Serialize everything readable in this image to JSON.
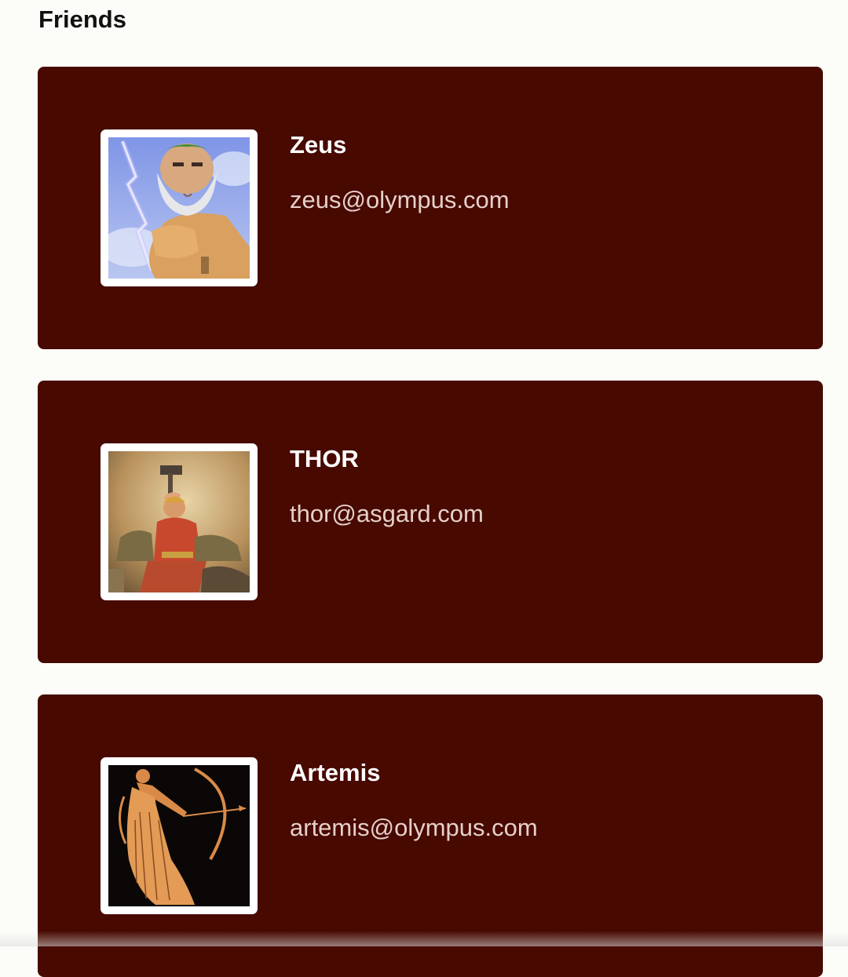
{
  "page": {
    "title": "Friends"
  },
  "theme": {
    "background": "#fcfdf8",
    "card_color": "#470900",
    "name_color": "#ffffff",
    "email_color": "#e6cfc9"
  },
  "friends": [
    {
      "name": "Zeus",
      "email": "zeus@olympus.com",
      "avatar_icon": "zeus-portrait-icon"
    },
    {
      "name": "THOR",
      "email": "thor@asgard.com",
      "avatar_icon": "thor-portrait-icon"
    },
    {
      "name": "Artemis",
      "email": "artemis@olympus.com",
      "avatar_icon": "artemis-portrait-icon"
    }
  ]
}
